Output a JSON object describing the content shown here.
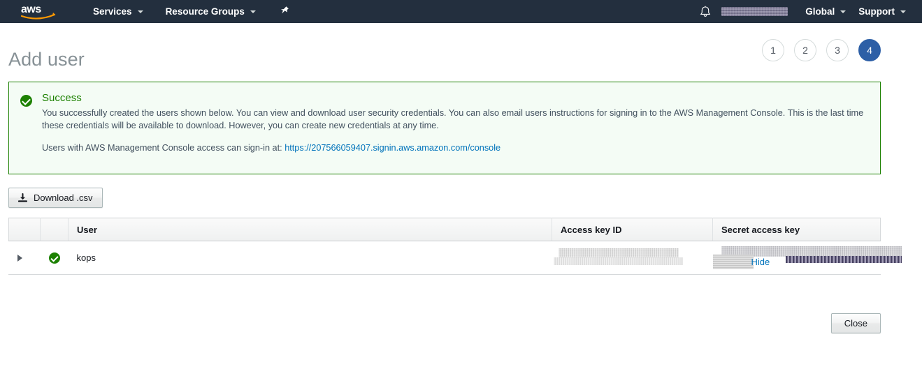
{
  "navbar": {
    "logo_alt": "aws",
    "services_label": "Services",
    "resource_groups_label": "Resource Groups",
    "pin_icon": "pin-icon",
    "bell_icon": "bell-icon",
    "account_label": "",
    "region_label": "Global",
    "support_label": "Support"
  },
  "header": {
    "title": "Add user",
    "steps": [
      {
        "number": "1",
        "active": false
      },
      {
        "number": "2",
        "active": false
      },
      {
        "number": "3",
        "active": false
      },
      {
        "number": "4",
        "active": true
      }
    ]
  },
  "alert": {
    "icon": "success-check-icon",
    "title": "Success",
    "body": "You successfully created the users shown below. You can view and download user security credentials. You can also email users instructions for signing in to the AWS Management Console. This is the last time these credentials will be available to download. However, you can create new credentials at any time.",
    "signin_prefix": "Users with AWS Management Console access can sign-in at:",
    "signin_url": "https://207566059407.signin.aws.amazon.com/console"
  },
  "toolbar": {
    "download_label": "Download .csv",
    "download_icon": "download-icon"
  },
  "table": {
    "columns": [
      "",
      "",
      "User",
      "Access key ID",
      "Secret access key"
    ],
    "rows": [
      {
        "expander_icon": "expand-triangle-icon",
        "status_icon": "success-check-icon",
        "user": "kops",
        "access_key_id": "",
        "secret_access_key": "",
        "hide_label": "Hide"
      }
    ]
  },
  "footer": {
    "close_label": "Close"
  },
  "colors": {
    "nav_bg": "#232f3e",
    "accent_blue": "#2d5fa6",
    "link_blue": "#0073bb",
    "success_green": "#1d8102",
    "alert_bg": "#f4fcf5",
    "title_gray": "#879196"
  }
}
